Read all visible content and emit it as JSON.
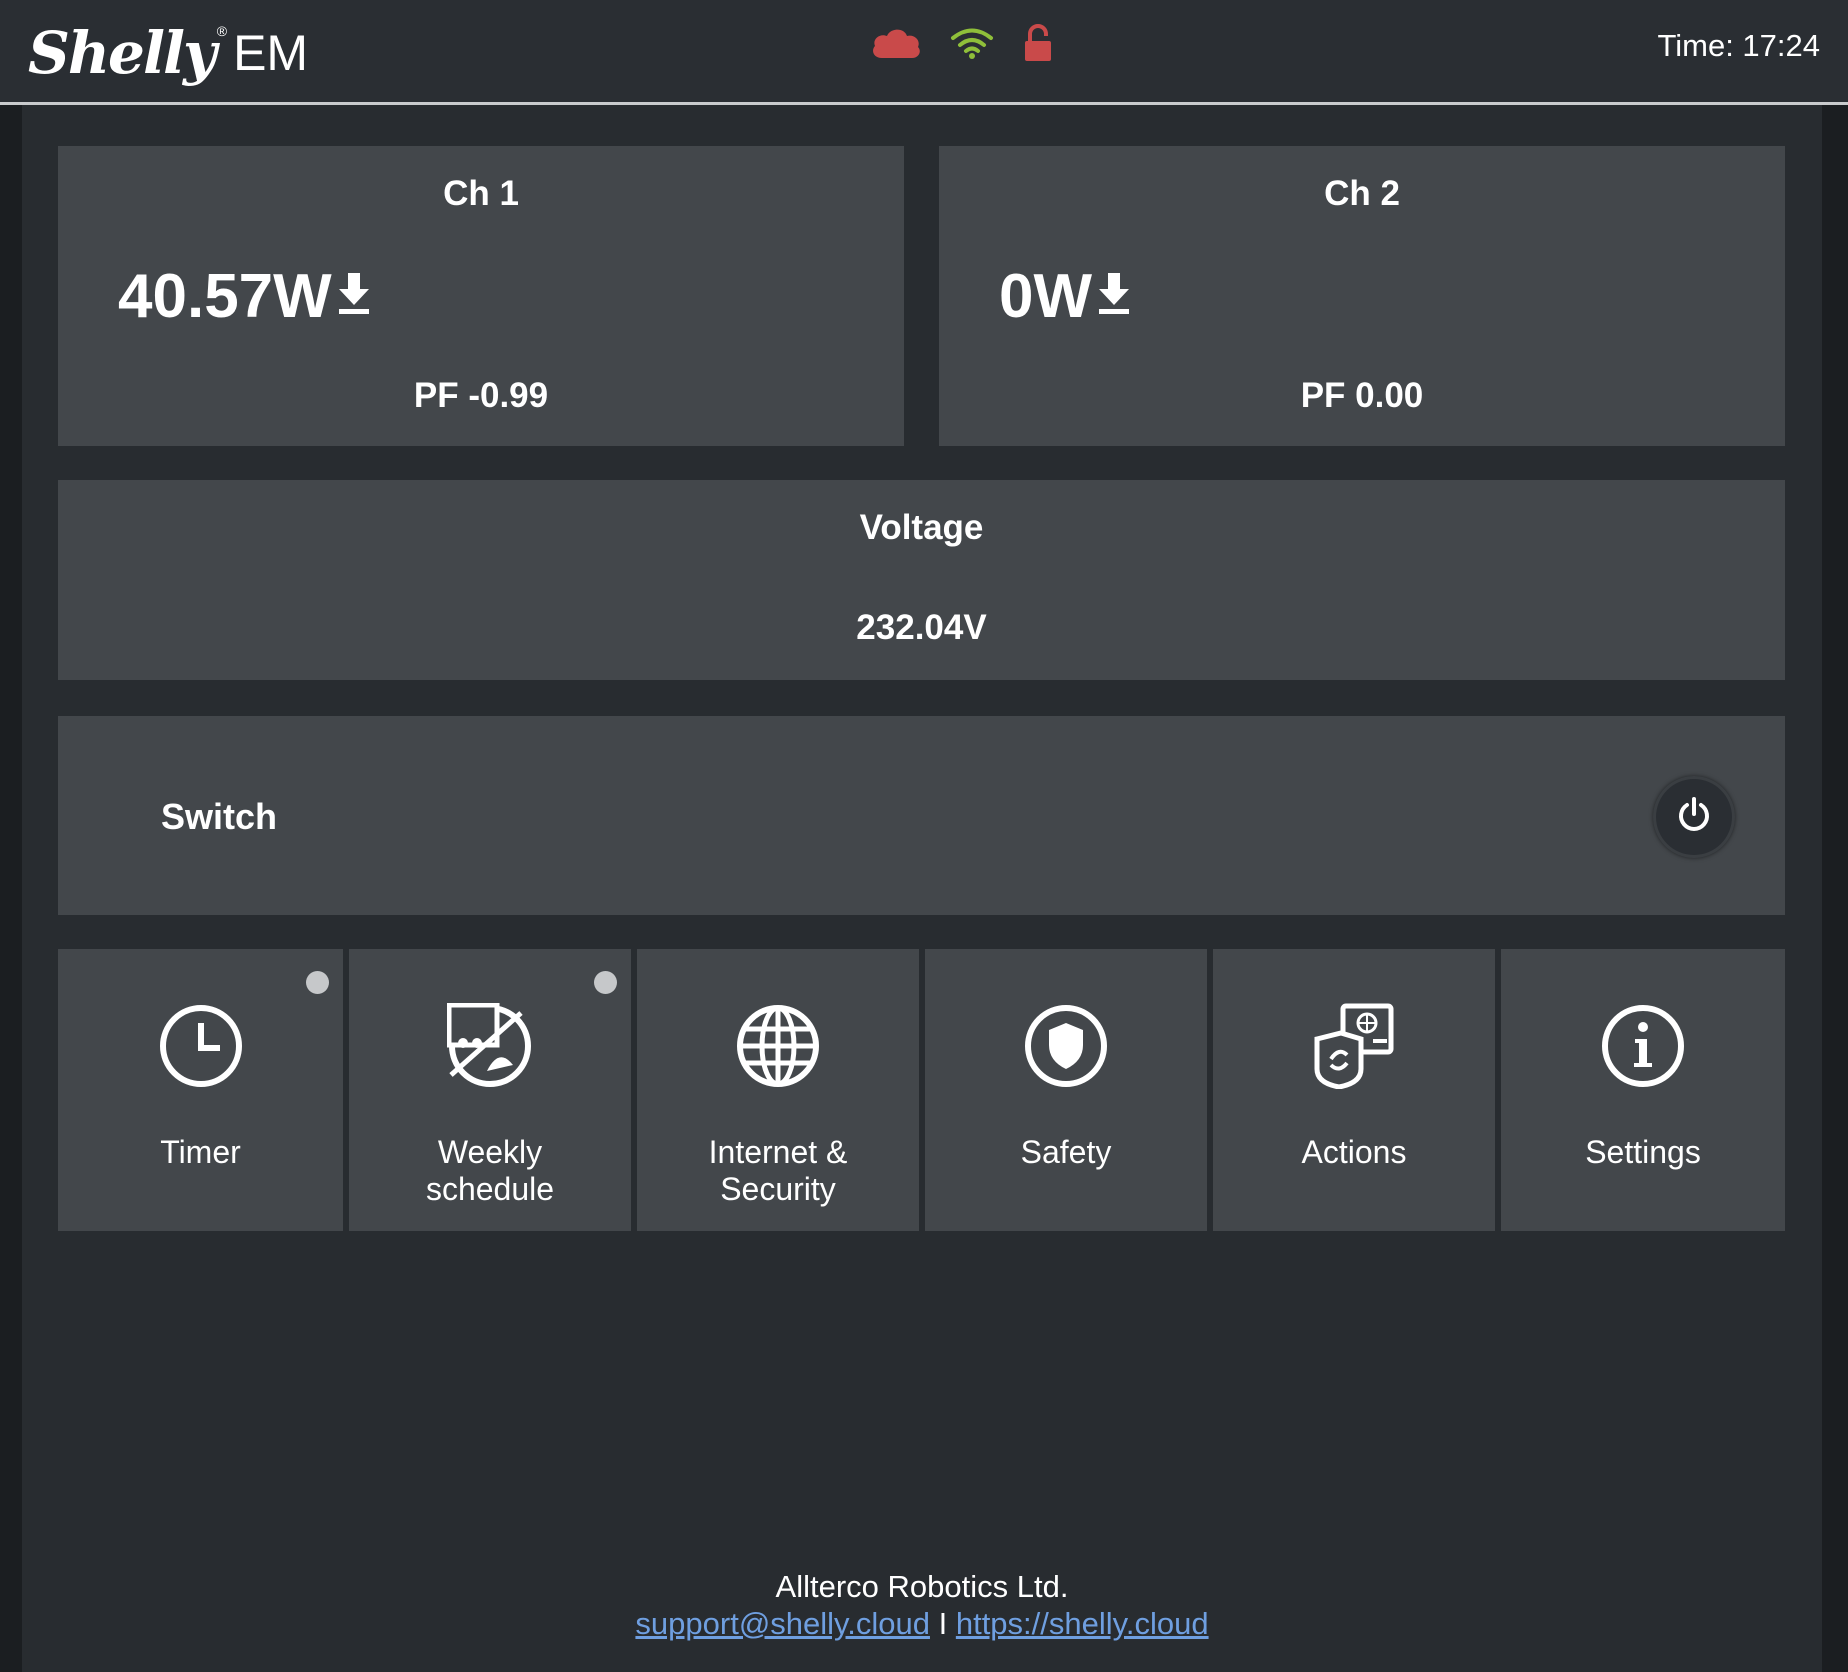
{
  "header": {
    "logo_script": "Shelly",
    "logo_registered": "®",
    "logo_model": "EM",
    "status_icons": [
      {
        "name": "cloud-icon",
        "color": "#c94a4a"
      },
      {
        "name": "wifi-icon",
        "color": "#8fbf3a"
      },
      {
        "name": "unlocked-icon",
        "color": "#c94a4a"
      }
    ],
    "time": "Time: 17:24"
  },
  "channels": [
    {
      "title": "Ch 1",
      "power": "40.57W",
      "direction_icon": "download-arrow-icon",
      "pf": "PF -0.99"
    },
    {
      "title": "Ch 2",
      "power": "0W",
      "direction_icon": "download-arrow-icon",
      "pf": "PF 0.00"
    }
  ],
  "voltage": {
    "title": "Voltage",
    "value": "232.04V"
  },
  "switch": {
    "label": "Switch",
    "button_icon": "power-icon"
  },
  "tiles": [
    {
      "label_line1": "Timer",
      "label_line2": "",
      "icon": "clock-icon",
      "indicator": true
    },
    {
      "label_line1": "Weekly",
      "label_line2": "schedule",
      "icon": "schedule-off-icon",
      "indicator": true
    },
    {
      "label_line1": "Internet &",
      "label_line2": "Security",
      "icon": "globe-icon",
      "indicator": false
    },
    {
      "label_line1": "Safety",
      "label_line2": "",
      "icon": "shield-icon",
      "indicator": false
    },
    {
      "label_line1": "Actions",
      "label_line2": "",
      "icon": "actions-icon",
      "indicator": false
    },
    {
      "label_line1": "Settings",
      "label_line2": "",
      "icon": "info-icon",
      "indicator": false
    }
  ],
  "footer": {
    "company": "Allterco Robotics Ltd.",
    "email": "support@shelly.cloud",
    "separator": "I",
    "website": "https://shelly.cloud"
  }
}
